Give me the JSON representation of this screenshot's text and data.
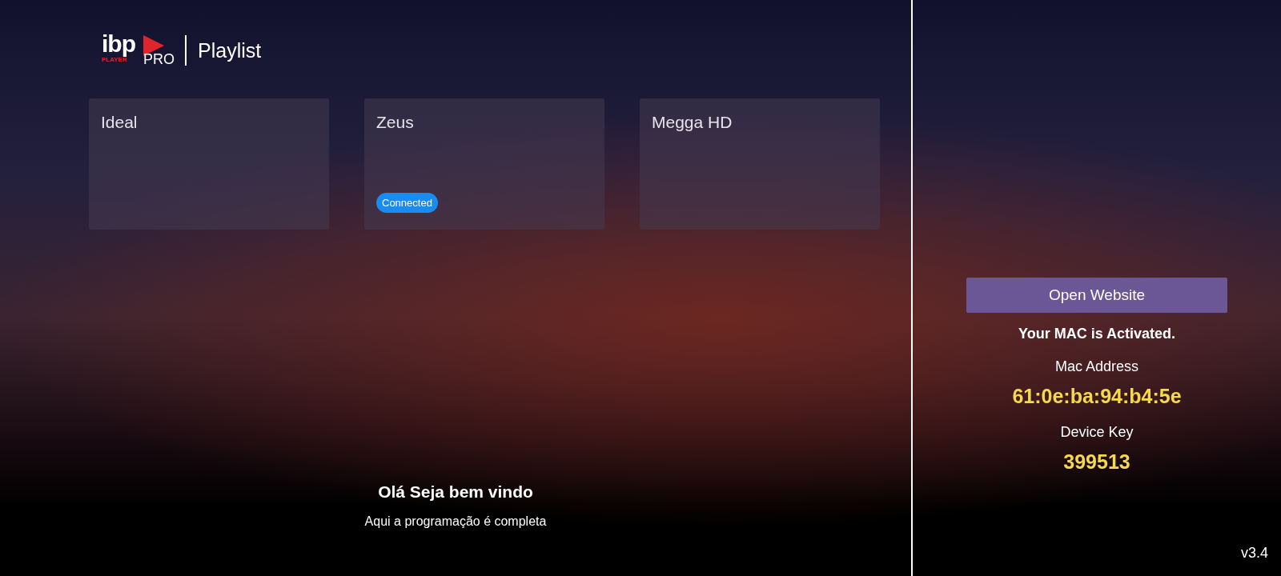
{
  "header": {
    "logo": {
      "main": "ibp",
      "sub": "PLAYER",
      "suffix": "PRO"
    },
    "title": "Playlist"
  },
  "playlists": [
    {
      "name": "Ideal",
      "connected": false
    },
    {
      "name": "Zeus",
      "connected": true,
      "badge": "Connected"
    },
    {
      "name": "Megga HD",
      "connected": false
    }
  ],
  "welcome": {
    "title": "Olá Seja bem vindo",
    "subtitle": "Aqui a programação é completa"
  },
  "sidebar": {
    "button": "Open Website",
    "status": "Your MAC is Activated.",
    "mac_label": "Mac Address",
    "mac_value": "61:0e:ba:94:b4:5e",
    "key_label": "Device Key",
    "key_value": "399513",
    "version": "v3.4"
  }
}
